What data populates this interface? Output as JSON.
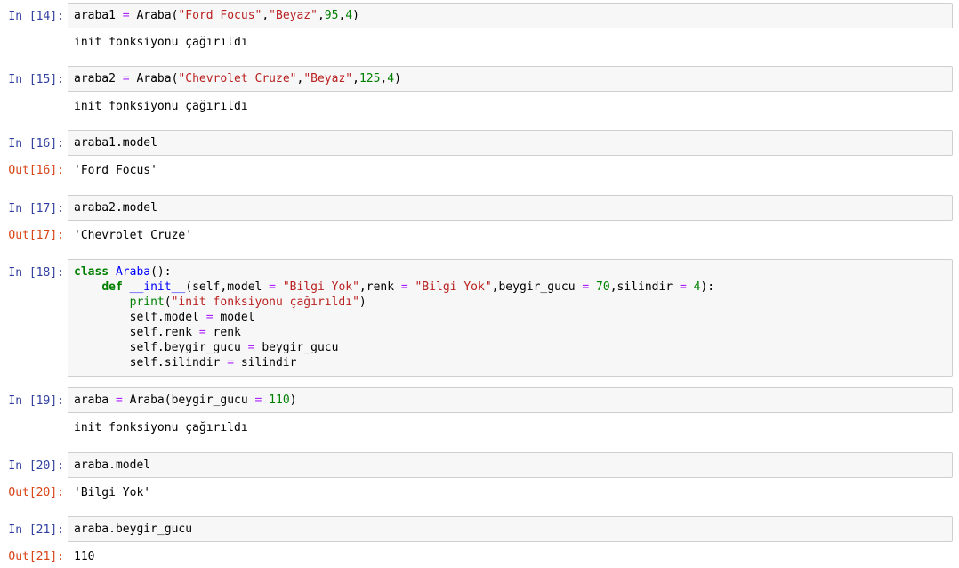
{
  "cells": [
    {
      "in_prompt": "In [14]:",
      "code": [
        [
          "araba1 ",
          "plain"
        ],
        [
          "=",
          "op"
        ],
        [
          " Araba(",
          "plain"
        ],
        [
          "\"Ford Focus\"",
          "str"
        ],
        [
          ",",
          "plain"
        ],
        [
          "\"Beyaz\"",
          "str"
        ],
        [
          ",",
          "plain"
        ],
        [
          "95",
          "num"
        ],
        [
          ",",
          "plain"
        ],
        [
          "4",
          "num"
        ],
        [
          ")",
          "plain"
        ]
      ],
      "stream_output": "init fonksiyonu çağırıldı"
    },
    {
      "in_prompt": "In [15]:",
      "code": [
        [
          "araba2 ",
          "plain"
        ],
        [
          "=",
          "op"
        ],
        [
          " Araba(",
          "plain"
        ],
        [
          "\"Chevrolet Cruze\"",
          "str"
        ],
        [
          ",",
          "plain"
        ],
        [
          "\"Beyaz\"",
          "str"
        ],
        [
          ",",
          "plain"
        ],
        [
          "125",
          "num"
        ],
        [
          ",",
          "plain"
        ],
        [
          "4",
          "num"
        ],
        [
          ")",
          "plain"
        ]
      ],
      "stream_output": "init fonksiyonu çağırıldı"
    },
    {
      "in_prompt": "In [16]:",
      "code": [
        [
          "araba1.model",
          "plain"
        ]
      ],
      "out_prompt": "Out[16]:",
      "result": "'Ford Focus'"
    },
    {
      "in_prompt": "In [17]:",
      "code": [
        [
          "araba2.model",
          "plain"
        ]
      ],
      "out_prompt": "Out[17]:",
      "result": "'Chevrolet Cruze'"
    },
    {
      "in_prompt": "In [18]:",
      "code": [
        [
          "class",
          "kw"
        ],
        [
          " ",
          "plain"
        ],
        [
          "Araba",
          "nf"
        ],
        [
          "():\n    ",
          "plain"
        ],
        [
          "def",
          "kw"
        ],
        [
          " ",
          "plain"
        ],
        [
          "__init__",
          "nf"
        ],
        [
          "(self,model ",
          "plain"
        ],
        [
          "=",
          "op"
        ],
        [
          " ",
          "plain"
        ],
        [
          "\"Bilgi Yok\"",
          "str"
        ],
        [
          ",renk ",
          "plain"
        ],
        [
          "=",
          "op"
        ],
        [
          " ",
          "plain"
        ],
        [
          "\"Bilgi Yok\"",
          "str"
        ],
        [
          ",beygir_gucu ",
          "plain"
        ],
        [
          "=",
          "op"
        ],
        [
          " ",
          "plain"
        ],
        [
          "70",
          "num"
        ],
        [
          ",silindir ",
          "plain"
        ],
        [
          "=",
          "op"
        ],
        [
          " ",
          "plain"
        ],
        [
          "4",
          "num"
        ],
        [
          "):\n        ",
          "plain"
        ],
        [
          "print",
          "nb"
        ],
        [
          "(",
          "plain"
        ],
        [
          "\"init fonksiyonu çağırıldı\"",
          "str"
        ],
        [
          ")\n        self.model ",
          "plain"
        ],
        [
          "=",
          "op"
        ],
        [
          " model\n        self.renk ",
          "plain"
        ],
        [
          "=",
          "op"
        ],
        [
          " renk\n        self.beygir_gucu ",
          "plain"
        ],
        [
          "=",
          "op"
        ],
        [
          " beygir_gucu\n        self.silindir ",
          "plain"
        ],
        [
          "=",
          "op"
        ],
        [
          " silindir",
          "plain"
        ]
      ]
    },
    {
      "in_prompt": "In [19]:",
      "code": [
        [
          "araba ",
          "plain"
        ],
        [
          "=",
          "op"
        ],
        [
          " Araba(beygir_gucu ",
          "plain"
        ],
        [
          "=",
          "op"
        ],
        [
          " ",
          "plain"
        ],
        [
          "110",
          "num"
        ],
        [
          ")",
          "plain"
        ]
      ],
      "stream_output": "init fonksiyonu çağırıldı"
    },
    {
      "in_prompt": "In [20]:",
      "code": [
        [
          "araba.model",
          "plain"
        ]
      ],
      "out_prompt": "Out[20]:",
      "result": "'Bilgi Yok'"
    },
    {
      "in_prompt": "In [21]:",
      "code": [
        [
          "araba.beygir_gucu",
          "plain"
        ]
      ],
      "out_prompt": "Out[21]:",
      "result": "110"
    }
  ]
}
